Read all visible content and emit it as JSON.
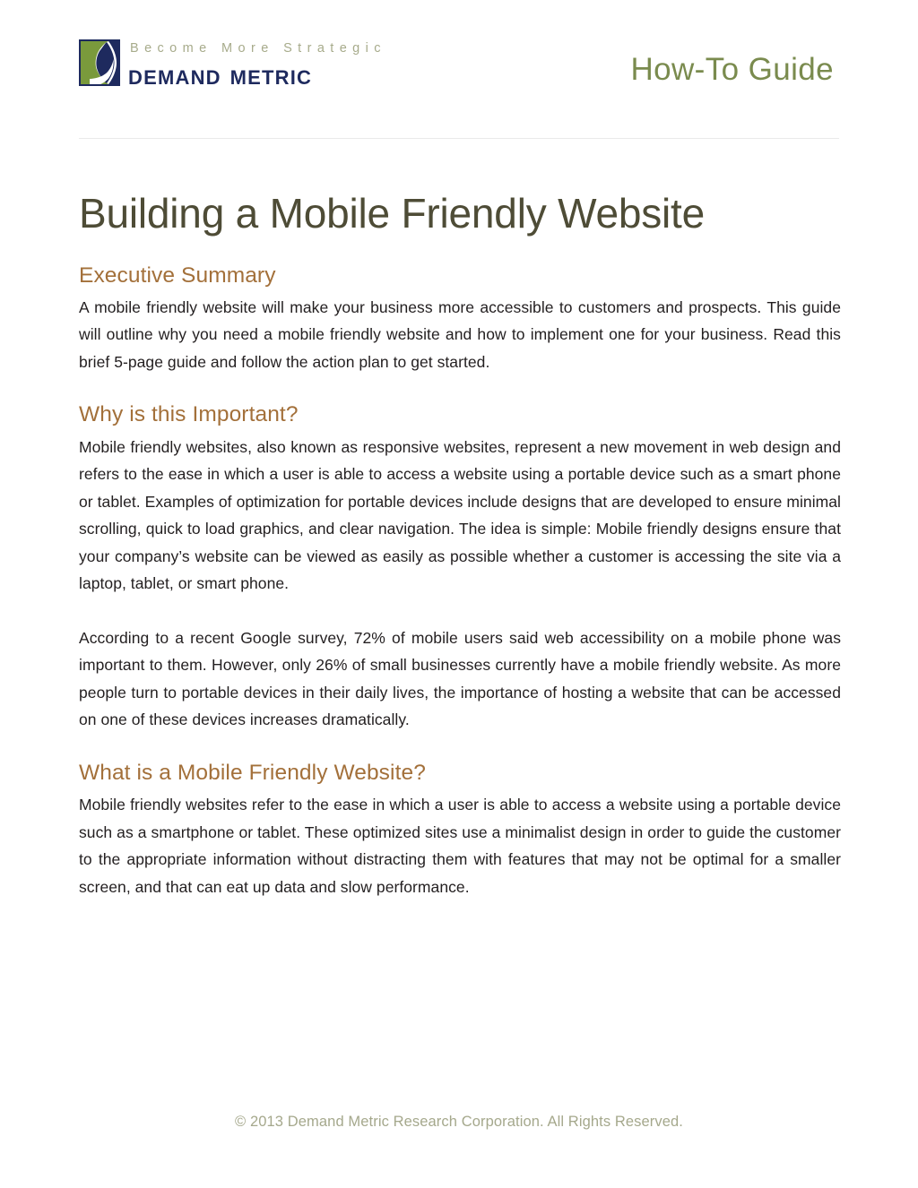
{
  "header": {
    "logo_icon": "demand-metric-logo-icon",
    "brand_tagline": "Become More Strategic",
    "brand_name": "Demand Metric",
    "document_kind": "How-To Guide"
  },
  "document": {
    "title": "Building a Mobile Friendly Website",
    "sections": [
      {
        "heading": "Executive Summary",
        "paragraphs": [
          "A mobile friendly website will make your business more accessible to customers and prospects. This guide will outline why you need a mobile friendly website and how to implement one for your business. Read this brief 5-page guide and follow the action plan to get started."
        ]
      },
      {
        "heading": "Why is this Important?",
        "paragraphs": [
          "Mobile friendly websites, also known as responsive websites, represent a new movement in web design and refers to the ease in which a user is able to access a website using a portable device such as a smart phone or tablet. Examples of optimization for portable devices include designs that are developed to ensure minimal scrolling, quick to load graphics, and clear navigation. The idea is simple: Mobile friendly designs ensure that your company’s website can be viewed as easily as possible whether a customer is accessing the site via a laptop, tablet, or smart phone.",
          "According to a recent Google survey, 72% of mobile users said web accessibility on a mobile phone was important to them. However, only 26% of small businesses currently have a mobile friendly website. As more people turn to portable devices in their daily lives, the importance of hosting a website that can be accessed on one of these devices increases dramatically."
        ]
      },
      {
        "heading": "What is a Mobile Friendly Website?",
        "paragraphs": [
          "Mobile friendly websites refer to the ease in which a user is able to access a website using a portable device such as a smartphone or tablet. These optimized sites use a minimalist design in order to guide the customer to the appropriate information without distracting them with features that may not be optimal for a smaller screen, and that can eat up data and slow performance."
        ]
      }
    ]
  },
  "footer": {
    "copyright": "© 2013 Demand Metric Research Corporation.  All Rights Reserved."
  },
  "colors": {
    "brand_navy": "#1e2a5e",
    "brand_green": "#7a9a3c",
    "tagline_olive": "#a7ab8b",
    "doc_kind_green": "#7a8b4e",
    "title_olive": "#4e4c36",
    "heading_brown": "#a3703a",
    "body_text": "#231f20",
    "footer_olive": "#a5a88c",
    "rule_gray": "#e9e9e9",
    "page_background": "#ffffff"
  }
}
